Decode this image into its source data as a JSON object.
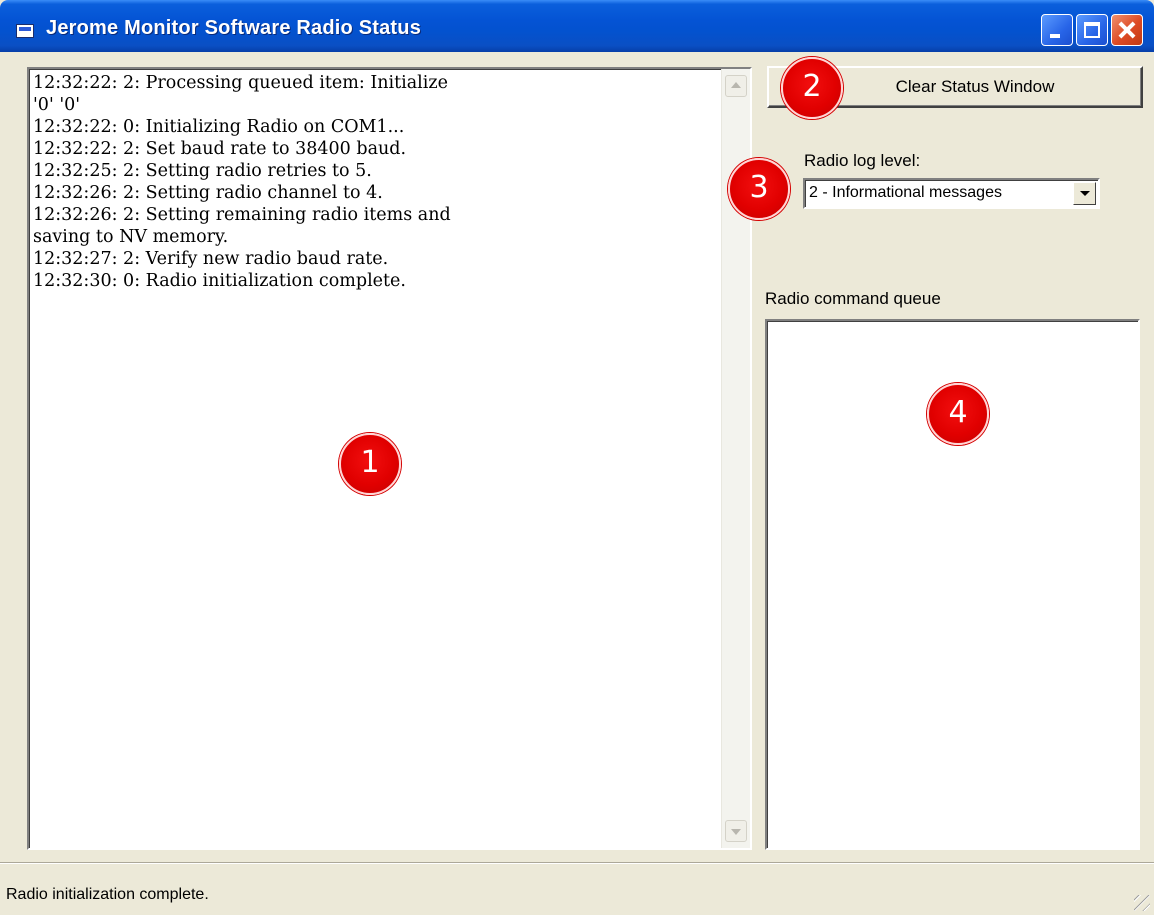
{
  "window": {
    "title": "Jerome Monitor Software Radio Status",
    "controls": [
      "minimize",
      "maximize",
      "close"
    ]
  },
  "log": {
    "lines": [
      "12:32:22: 2: Processing queued item: Initialize",
      "'0'  '0'",
      "12:32:22: 0: Initializing Radio on COM1...",
      "12:32:22: 2: Set baud rate to 38400 baud.",
      "12:32:25: 2: Setting radio retries to 5.",
      "12:32:26: 2: Setting radio channel to 4.",
      "12:32:26: 2: Setting remaining radio items and",
      "saving to NV memory.",
      "12:32:27: 2: Verify new radio baud rate.",
      "12:32:30: 0: Radio initialization complete."
    ]
  },
  "controls": {
    "clear_button": "Clear Status Window",
    "log_level_label": "Radio log level:",
    "log_level_value": "2 - Informational messages",
    "queue_label": "Radio command queue"
  },
  "status_bar": {
    "text": "Radio initialization complete."
  },
  "markers": [
    "1",
    "2",
    "3",
    "4"
  ],
  "colors": {
    "titlebar": "#0453d4",
    "marker": "#e10000",
    "window_bg": "#ece9d8"
  }
}
